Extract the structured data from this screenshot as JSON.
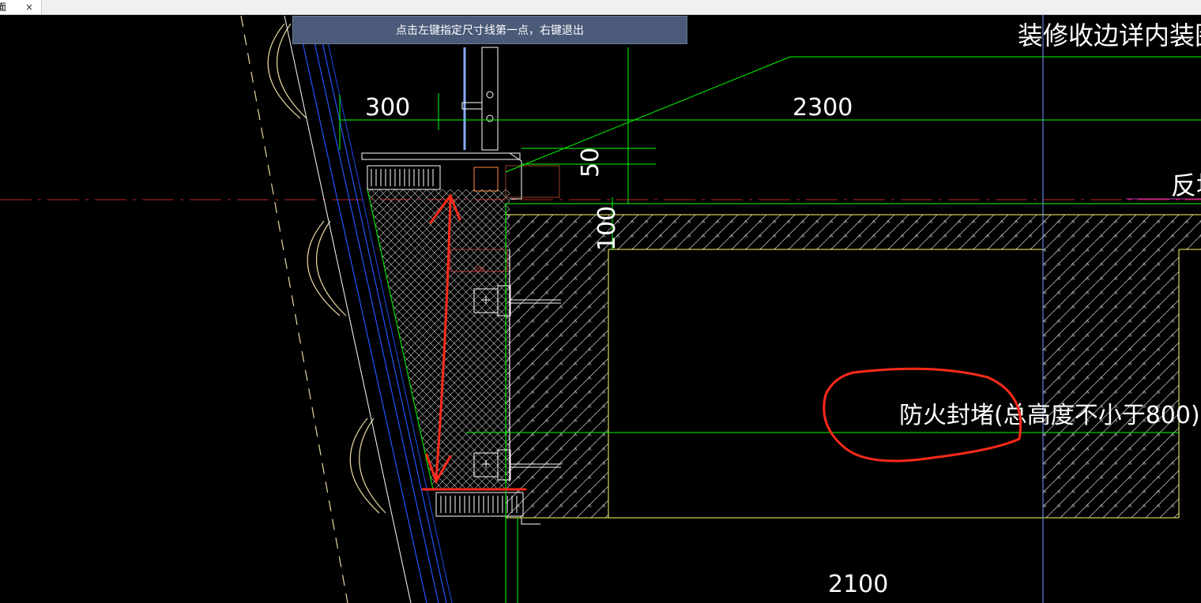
{
  "tab": {
    "label": "面",
    "close": "×"
  },
  "prompt": {
    "text": "点击左键指定尺寸线第一点，右键退出"
  },
  "drawing": {
    "title": "装修收边详内装图",
    "right_label": "反坎",
    "dims": {
      "d300": "300",
      "d2300": "2300",
      "d50": "50",
      "d100": "100",
      "d2100": "2100",
      "small": "200"
    },
    "annotation": "防火封堵(总高度不小于800)"
  },
  "colors": {
    "background": "#000000",
    "dimension_line": "#00ff00",
    "outline": "#ffff66",
    "hatch": "#ffffff",
    "glass": "#2255ff",
    "markup": "#ff2a1a",
    "prompt_bg": "#4a5a78"
  }
}
